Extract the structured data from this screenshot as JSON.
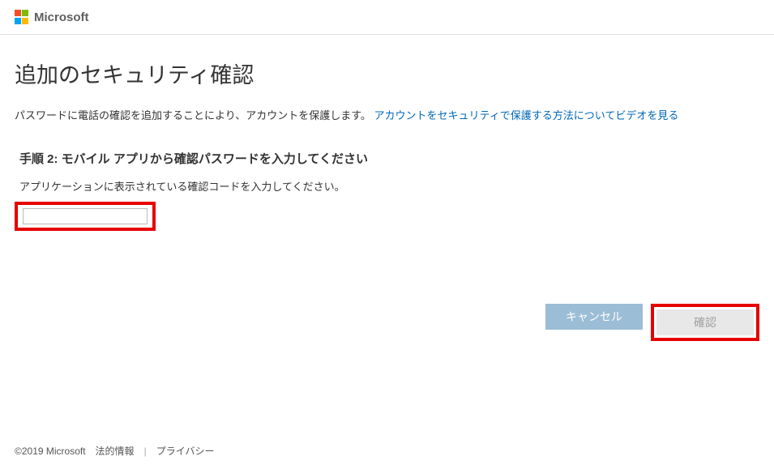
{
  "header": {
    "brand": "Microsoft"
  },
  "main": {
    "title": "追加のセキュリティ確認",
    "description_prefix": "パスワードに電話の確認を追加することにより、アカウントを保護します。",
    "description_link": "アカウントをセキュリティで保護する方法についてビデオを見る",
    "step_title": "手順 2: モバイル アプリから確認パスワードを入力してください",
    "step_instruction": "アプリケーションに表示されている確認コードを入力してください。",
    "code_value": ""
  },
  "actions": {
    "cancel_label": "キャンセル",
    "confirm_label": "確認"
  },
  "footer": {
    "copyright": "©2019 Microsoft",
    "legal": "法的情報",
    "privacy": "プライバシー"
  }
}
